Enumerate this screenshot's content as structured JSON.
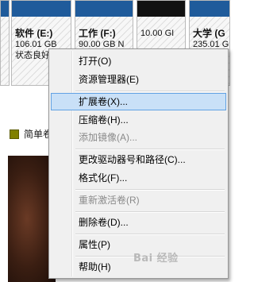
{
  "volumes": [
    {
      "name": "软件  (E:)",
      "size": "106.01 GB",
      "status": "状态良好"
    },
    {
      "name": "工作  (F:)",
      "size": "90.00 GB N"
    },
    {
      "name": "",
      "size": "10.00 GI"
    },
    {
      "name": "大学  (G",
      "size": "235.01 G"
    }
  ],
  "legend": {
    "label": "简单卷"
  },
  "menu": {
    "items": [
      {
        "label": "打开(O)",
        "disabled": false
      },
      {
        "label": "资源管理器(E)",
        "disabled": false
      },
      {
        "label": "扩展卷(X)...",
        "disabled": false,
        "highlighted": true
      },
      {
        "label": "压缩卷(H)...",
        "disabled": false
      },
      {
        "label": "添加镜像(A)...",
        "disabled": true
      },
      {
        "label": "更改驱动器号和路径(C)...",
        "disabled": false
      },
      {
        "label": "格式化(F)...",
        "disabled": false
      },
      {
        "label": "重新激活卷(R)",
        "disabled": true
      },
      {
        "label": "删除卷(D)...",
        "disabled": false
      },
      {
        "label": "属性(P)",
        "disabled": false
      },
      {
        "label": "帮助(H)",
        "disabled": false
      }
    ]
  },
  "watermark": "Bai 经验"
}
